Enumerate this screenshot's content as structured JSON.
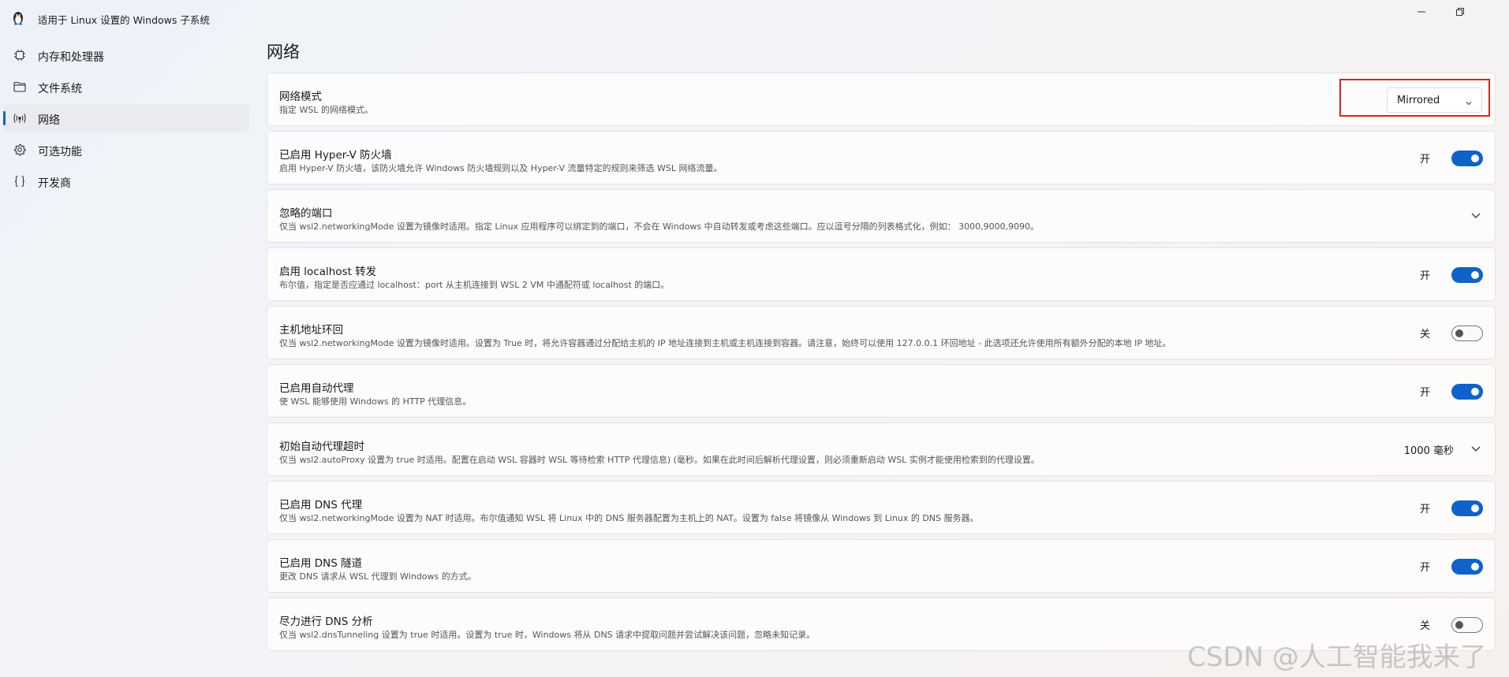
{
  "window": {
    "title": "适用于 Linux 设置的 Windows 子系统",
    "minimize_icon": "minimize-icon",
    "restore_icon": "restore-icon"
  },
  "sidebar": {
    "items": [
      {
        "label": "内存和处理器",
        "icon": "cpu-icon"
      },
      {
        "label": "文件系统",
        "icon": "folder-icon"
      },
      {
        "label": "网络",
        "icon": "network-icon"
      },
      {
        "label": "可选功能",
        "icon": "gear-icon"
      },
      {
        "label": "开发商",
        "icon": "braces-icon"
      }
    ],
    "active_index": 2
  },
  "main": {
    "title": "网络",
    "settings": [
      {
        "title": "网络模式",
        "desc": "指定 WSL 的网络模式。",
        "control": "dropdown",
        "value": "Mirrored"
      },
      {
        "title": "已启用 Hyper-V 防火墙",
        "desc": "启用 Hyper-V 防火墙，该防火墙允许 Windows 防火墙规则以及 Hyper-V 流量特定的规则来筛选 WSL 网络流量。",
        "control": "toggle",
        "state_label": "开",
        "on": true
      },
      {
        "title": "忽略的端口",
        "desc": "仅当 wsl2.networkingMode 设置为镜像时适用。指定 Linux 应用程序可以绑定到的端口，不会在 Windows 中自动转发或考虑这些端口。应以逗号分隔的列表格式化，例如： 3000,9000,9090。",
        "control": "expander",
        "value": ""
      },
      {
        "title": "启用 localhost 转发",
        "desc": "布尔值，指定是否应通过 localhost：port 从主机连接到 WSL 2 VM 中通配符或 localhost 的端口。",
        "control": "toggle",
        "state_label": "开",
        "on": true
      },
      {
        "title": "主机地址环回",
        "desc": "仅当 wsl2.networkingMode 设置为镜像时适用。设置为 True 时，将允许容器通过分配给主机的 IP 地址连接到主机或主机连接到容器。请注意，始终可以使用 127.0.0.1 环回地址 - 此选项还允许使用所有额外分配的本地 IP 地址。",
        "control": "toggle",
        "state_label": "关",
        "on": false
      },
      {
        "title": "已启用自动代理",
        "desc": "使 WSL 能够使用 Windows 的 HTTP 代理信息。",
        "control": "toggle",
        "state_label": "开",
        "on": true
      },
      {
        "title": "初始自动代理超时",
        "desc": "仅当 wsl2.autoProxy 设置为 true 时适用。配置在启动 WSL 容器时 WSL 等待检索 HTTP 代理信息) (毫秒。如果在此时间后解析代理设置，则必须重新启动 WSL 实例才能使用检索到的代理设置。",
        "control": "expander",
        "value": "1000 毫秒"
      },
      {
        "title": "已启用 DNS 代理",
        "desc": "仅当 wsl2.networkingMode 设置为 NAT 时适用。布尔值通知 WSL 将 Linux 中的 DNS 服务器配置为主机上的 NAT。设置为 false 将镜像从 Windows 到 Linux 的 DNS 服务器。",
        "control": "toggle",
        "state_label": "开",
        "on": true
      },
      {
        "title": "已启用 DNS 隧道",
        "desc": "更改 DNS 请求从 WSL 代理到 Windows 的方式。",
        "control": "toggle",
        "state_label": "开",
        "on": true
      },
      {
        "title": "尽力进行 DNS 分析",
        "desc": "仅当 wsl2.dnsTunneling 设置为 true 时适用。设置为 true 时，Windows 将从 DNS 请求中提取问题并尝试解决该问题，忽略未知记录。",
        "control": "toggle",
        "state_label": "关",
        "on": false
      }
    ]
  },
  "watermark": "CSDN @人工智能我来了",
  "colors": {
    "accent": "#0f62c9",
    "highlight": "#e02020"
  }
}
